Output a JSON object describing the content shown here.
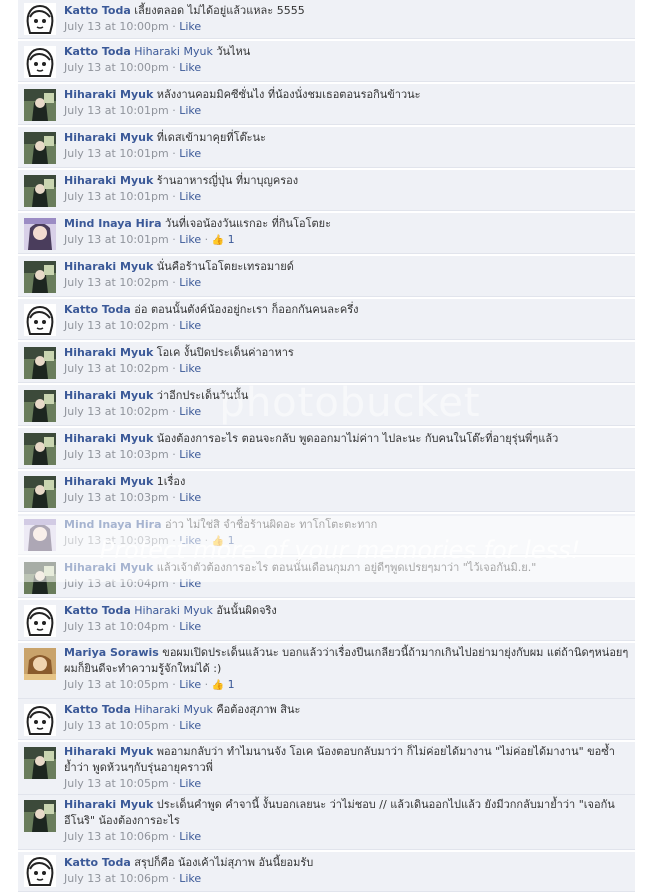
{
  "comments": [
    {
      "author": "Katto Toda",
      "avatar": "katto",
      "mention": "",
      "text": "เลี้ยงตลอด ไม่ได้อยู่แล้วแหละ 5555",
      "time": "July 13 at 10:00pm",
      "like_label": "Like",
      "likes": ""
    },
    {
      "author": "Katto Toda",
      "avatar": "katto",
      "mention": "Hiharaki Myuk",
      "text": "วันไหน",
      "time": "July 13 at 10:00pm",
      "like_label": "Like",
      "likes": ""
    },
    {
      "author": "Hiharaki Myuk",
      "avatar": "hiharaki",
      "mention": "",
      "text": "หลังงานคอมมิคซีซั่นไง ที่น้องนั่งชมเธอตอนรอกินข้าวนะ",
      "time": "July 13 at 10:01pm",
      "like_label": "Like",
      "likes": ""
    },
    {
      "author": "Hiharaki Myuk",
      "avatar": "hiharaki",
      "mention": "",
      "text": "ที่เดสเข้ามาคุยที่โต๊ะนะ",
      "time": "July 13 at 10:01pm",
      "like_label": "Like",
      "likes": ""
    },
    {
      "author": "Hiharaki Myuk",
      "avatar": "hiharaki",
      "mention": "",
      "text": "ร้านอาหารญี่ปุ่น ที่มาบุญครอง",
      "time": "July 13 at 10:01pm",
      "like_label": "Like",
      "likes": ""
    },
    {
      "author": "Mind Inaya Hira",
      "avatar": "mind",
      "mention": "",
      "text": "วันที่เจอน้องวันแรกอะ ที่กินโอโตยะ",
      "time": "July 13 at 10:01pm",
      "like_label": "Like",
      "likes": "1"
    },
    {
      "author": "Hiharaki Myuk",
      "avatar": "hiharaki",
      "mention": "",
      "text": "นั่นคือร้านโอโตยะเทรอมายด์",
      "time": "July 13 at 10:02pm",
      "like_label": "Like",
      "likes": ""
    },
    {
      "author": "Katto Toda",
      "avatar": "katto",
      "mention": "",
      "text": "อ่อ ตอนนั้นตังค์น้องอยู่กะเรา ก็ออกกันคนละครึ่ง",
      "time": "July 13 at 10:02pm",
      "like_label": "Like",
      "likes": ""
    },
    {
      "author": "Hiharaki Myuk",
      "avatar": "hiharaki",
      "mention": "",
      "text": "โอเค งั้นปิดประเด็นค่าอาหาร",
      "time": "July 13 at 10:02pm",
      "like_label": "Like",
      "likes": ""
    },
    {
      "author": "Hiharaki Myuk",
      "avatar": "hiharaki",
      "mention": "",
      "text": "ว่าอีกประเด็นวันนั้น",
      "time": "July 13 at 10:02pm",
      "like_label": "Like",
      "likes": ""
    },
    {
      "author": "Hiharaki Myuk",
      "avatar": "hiharaki",
      "mention": "",
      "text": "น้องต้องการอะไร ตอนจะกลับ พูดออกมาไม่ค่าา ไปละนะ กับคนในโต๊ะที่อายุรุ่นพี่ๆแล้ว",
      "time": "July 13 at 10:03pm",
      "like_label": "Like",
      "likes": ""
    },
    {
      "author": "Hiharaki Myuk",
      "avatar": "hiharaki",
      "mention": "",
      "text": "1เรื่อง",
      "time": "July 13 at 10:03pm",
      "like_label": "Like",
      "likes": ""
    },
    {
      "author": "Mind Inaya Hira",
      "avatar": "mind",
      "mention": "",
      "text": "อ่าว ไม่ใช่สิ จำชื่อร้านผิดอะ ทาโกโตะตะทาก",
      "time": "July 13 at 10:03pm",
      "like_label": "Like",
      "likes": "1"
    },
    {
      "author": "Hiharaki Myuk",
      "avatar": "hiharaki",
      "mention": "",
      "text": "แล้วเจ้าตัวต้องการอะไร ตอนนั้นเดือนกุมภา อยู่ดีๆพูดเปรยๆมาว่า \"ไว้เจอกันมิ.ย.\"",
      "time": "July 13 at 10:04pm",
      "like_label": "Like",
      "likes": ""
    },
    {
      "author": "Katto Toda",
      "avatar": "katto",
      "mention": "Hiharaki Myuk",
      "text": "อันนั้นผิดจริง",
      "time": "July 13 at 10:04pm",
      "like_label": "Like",
      "likes": ""
    },
    {
      "author": "Mariya Sorawis",
      "avatar": "mariya",
      "mention": "",
      "text": "ขอผมเปิดประเด็นแล้วนะ บอกแล้วว่าเรื่องปีนเกลียวนี้ถ้ามากเกินไปอย่ามายุ่งกับผม แต่ถ้านิดๆหน่อยๆ ผมก็ยินดีจะทำความรู้จักใหม่ได้ :)",
      "time": "July 13 at 10:05pm",
      "like_label": "Like",
      "likes": "1"
    },
    {
      "author": "Katto Toda",
      "avatar": "katto",
      "mention": "Hiharaki Myuk",
      "text": "คือต้องสุภาพ สินะ",
      "time": "July 13 at 10:05pm",
      "like_label": "Like",
      "likes": ""
    },
    {
      "author": "Hiharaki Myuk",
      "avatar": "hiharaki",
      "mention": "",
      "text": "พออามกลับว่า ทำไมนานจัง โอเค น้องตอบกลับมาว่า ก็ไม่ค่อยได้มางาน \"ไม่ค่อยได้มางาน\" ขอซ้ำ ย้ำว่า พูดห้วนๆกับรุ่นอายุคราวพี่",
      "time": "July 13 at 10:05pm",
      "like_label": "Like",
      "likes": ""
    },
    {
      "author": "Hiharaki Myuk",
      "avatar": "hiharaki",
      "mention": "",
      "text": "ประเด็นคำพูด คำจานี้ งั้นบอกเลยนะ ว่าไม่ชอบ // แล้วเดินออกไปแล้ว ยังมีวกกลับมาย้ำว่า \"เจอกัน อีโนริ\" น้องต้องการอะไร",
      "time": "July 13 at 10:06pm",
      "like_label": "Like",
      "likes": ""
    },
    {
      "author": "Katto Toda",
      "avatar": "katto",
      "mention": "",
      "text": "สรุปก็คือ น้องเค้าไม่สุภาพ อันนี้ยอมรับ",
      "time": "July 13 at 10:06pm",
      "like_label": "Like",
      "likes": ""
    }
  ],
  "watermark": {
    "brand": "photobucket",
    "tagline": "Protect more of your memories for less!"
  }
}
